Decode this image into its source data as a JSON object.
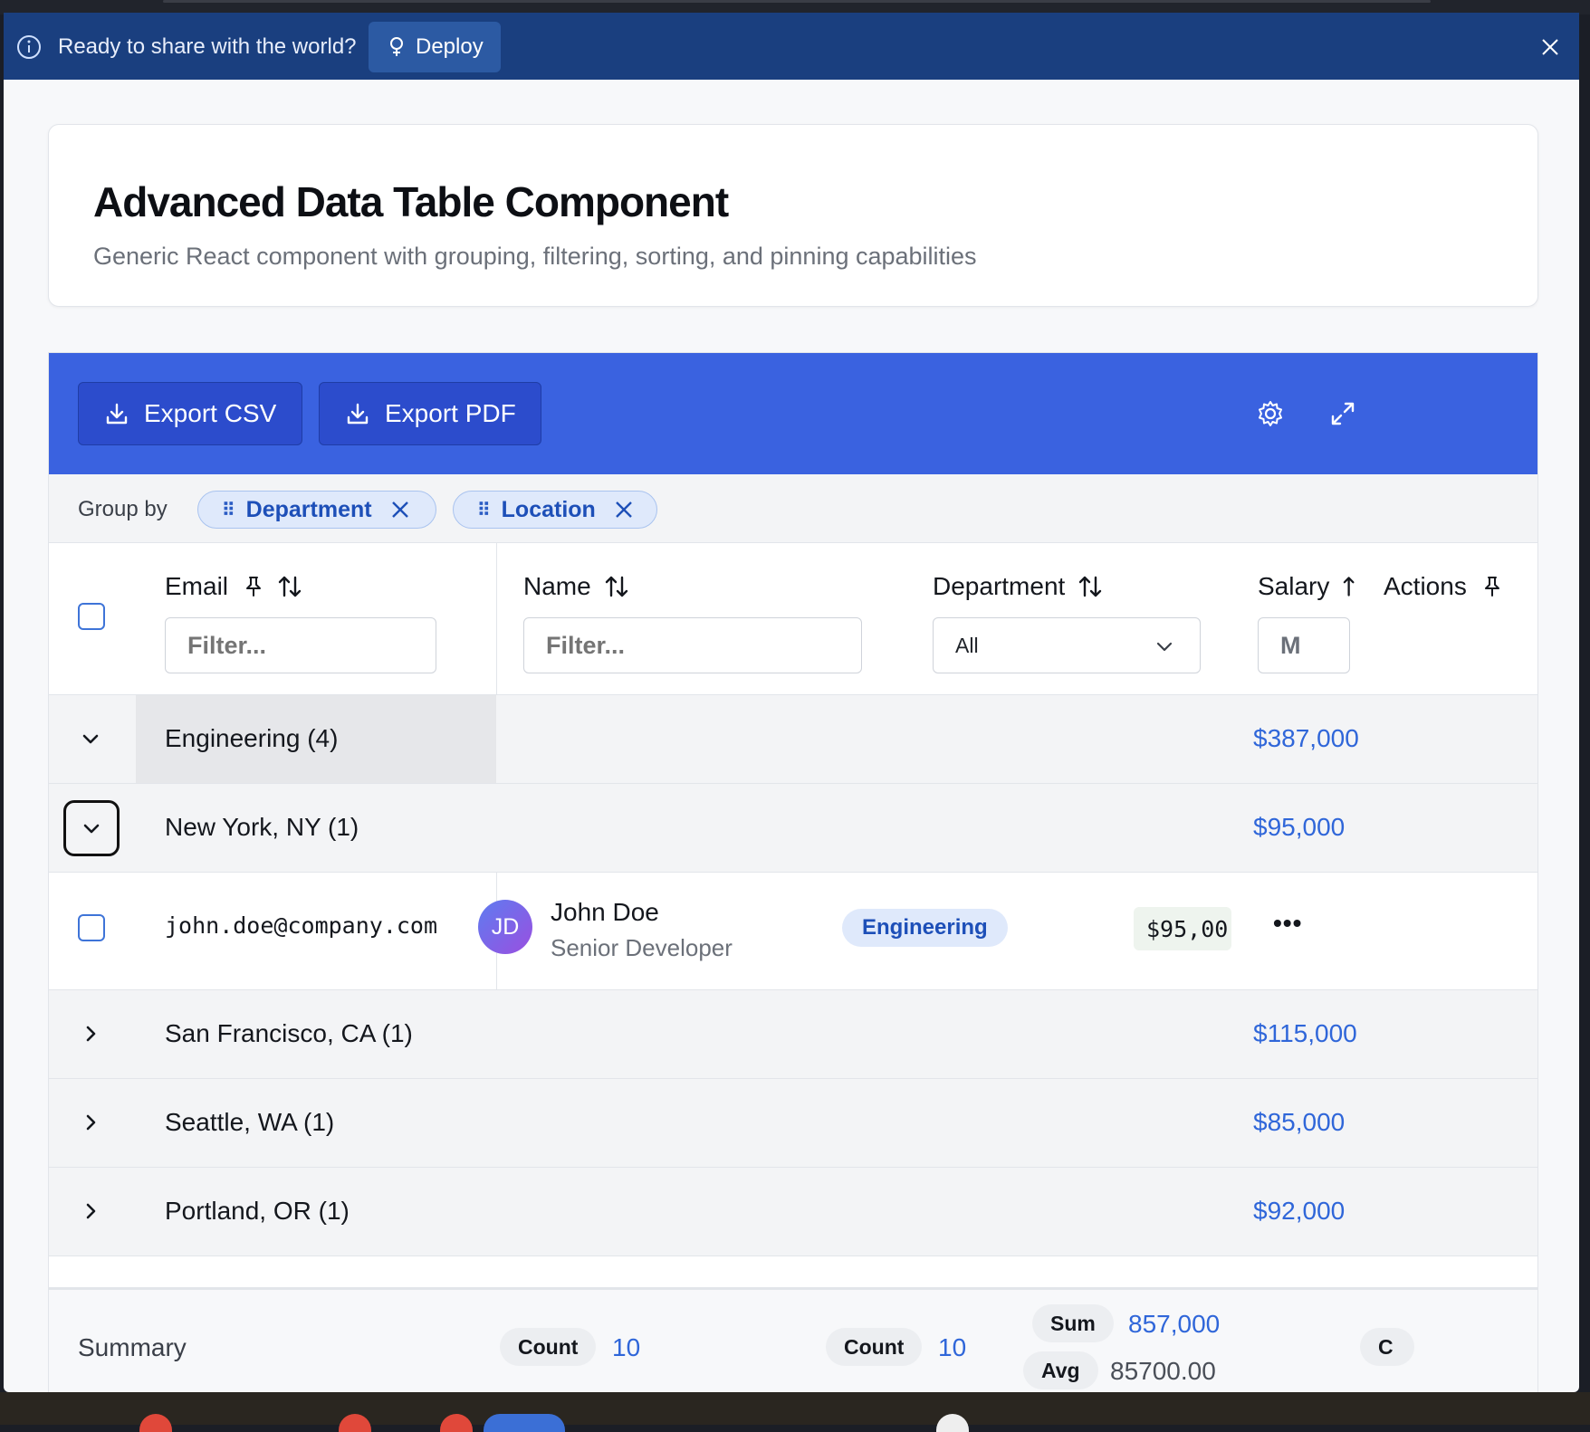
{
  "banner": {
    "message": "Ready to share with the world?",
    "deploy_label": "Deploy"
  },
  "page": {
    "title": "Advanced Data Table Component",
    "subtitle": "Generic React component with grouping, filtering, sorting, and pinning capabilities"
  },
  "toolbar": {
    "export_csv": "Export CSV",
    "export_pdf": "Export PDF",
    "settings_icon": "gear-icon",
    "fullscreen_icon": "expand-icon"
  },
  "group_by": {
    "label": "Group by",
    "chips": [
      {
        "label": "Department"
      },
      {
        "label": "Location"
      }
    ]
  },
  "columns": {
    "email": {
      "label": "Email",
      "filter_placeholder": "Filter..."
    },
    "name": {
      "label": "Name",
      "filter_placeholder": "Filter..."
    },
    "department": {
      "label": "Department",
      "filter_value": "All"
    },
    "salary": {
      "label": "Salary",
      "filter_value": "M"
    },
    "actions": {
      "label": "Actions"
    }
  },
  "groups": {
    "engineering": {
      "label": "Engineering (4)",
      "total": "$387,000"
    },
    "new_york": {
      "label": "New York, NY (1)",
      "total": "$95,000"
    },
    "san_francisco": {
      "label": "San Francisco, CA (1)",
      "total": "$115,000"
    },
    "seattle": {
      "label": "Seattle, WA (1)",
      "total": "$85,000"
    },
    "portland": {
      "label": "Portland, OR (1)",
      "total": "$92,000"
    }
  },
  "record": {
    "email": "john.doe@company.com",
    "initials": "JD",
    "name": "John Doe",
    "role": "Senior Developer",
    "department": "Engineering",
    "salary": "$95,00",
    "actions": "•••"
  },
  "summary": {
    "label": "Summary",
    "email_count_label": "Count",
    "email_count": "10",
    "dept_count_label": "Count",
    "dept_count": "10",
    "sum_label": "Sum",
    "sum": "857,000",
    "avg_label": "Avg",
    "avg": "85700.00",
    "actions_partial": "C"
  },
  "colors": {
    "banner": "#1a3f7f",
    "toolbar": "#3a62e0",
    "accent": "#2f66d9"
  }
}
